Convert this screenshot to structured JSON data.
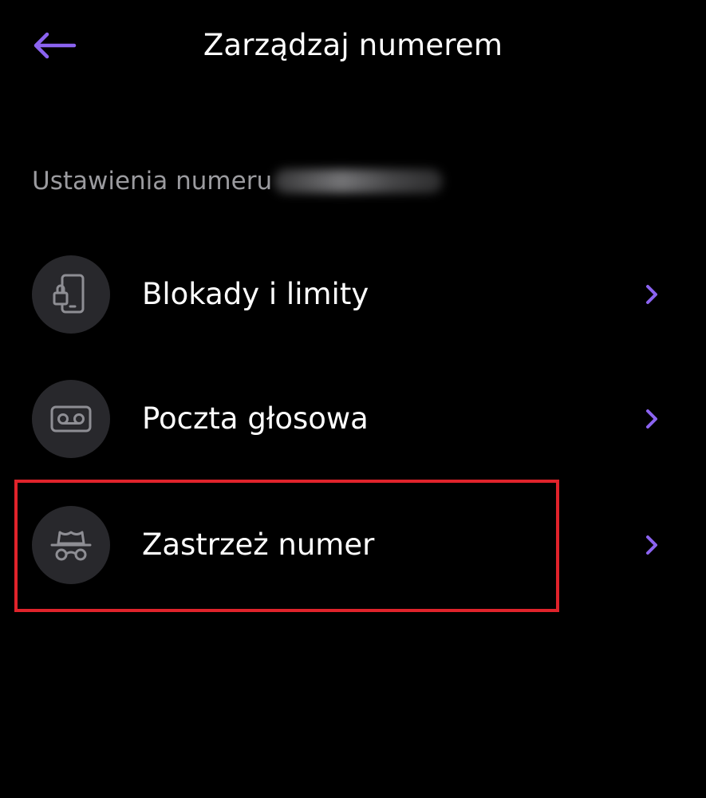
{
  "header": {
    "title": "Zarządzaj numerem",
    "back_icon": "arrow-left-icon"
  },
  "section": {
    "label": "Ustawienia numeru",
    "number_redacted": true
  },
  "menu": {
    "items": [
      {
        "label": "Blokady i limity",
        "icon": "phone-lock-icon"
      },
      {
        "label": "Poczta głosowa",
        "icon": "voicemail-icon"
      },
      {
        "label": "Zastrzeż numer",
        "icon": "incognito-icon",
        "highlighted": true
      }
    ]
  },
  "colors": {
    "background": "#000000",
    "accent": "#8b63f0",
    "icon_circle": "#28282c",
    "icon_stroke": "#8e8e94",
    "section_label": "#9b9b9f",
    "highlight": "#e0232b"
  }
}
